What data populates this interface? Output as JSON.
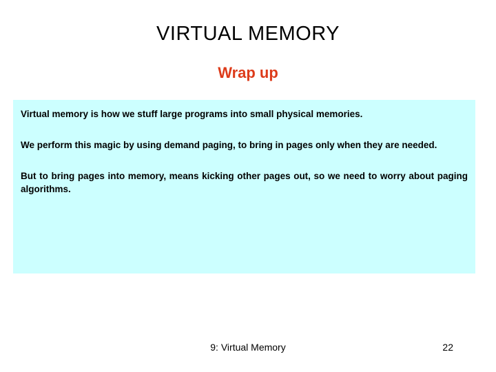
{
  "slide": {
    "title": "VIRTUAL MEMORY",
    "subtitle": "Wrap up",
    "accent_color": "#DD3B1A",
    "box_color": "#CCFFFF",
    "text_color": "#000000",
    "body_paragraphs": [
      "Virtual memory is how we stuff large programs into small physical memories.",
      "We perform this magic by using demand paging, to bring in pages only when they are needed.",
      "But to bring pages into memory, means kicking other pages out, so we need to worry about paging algorithms."
    ],
    "footer": {
      "title": "9: Virtual Memory",
      "page_number": "22"
    }
  }
}
